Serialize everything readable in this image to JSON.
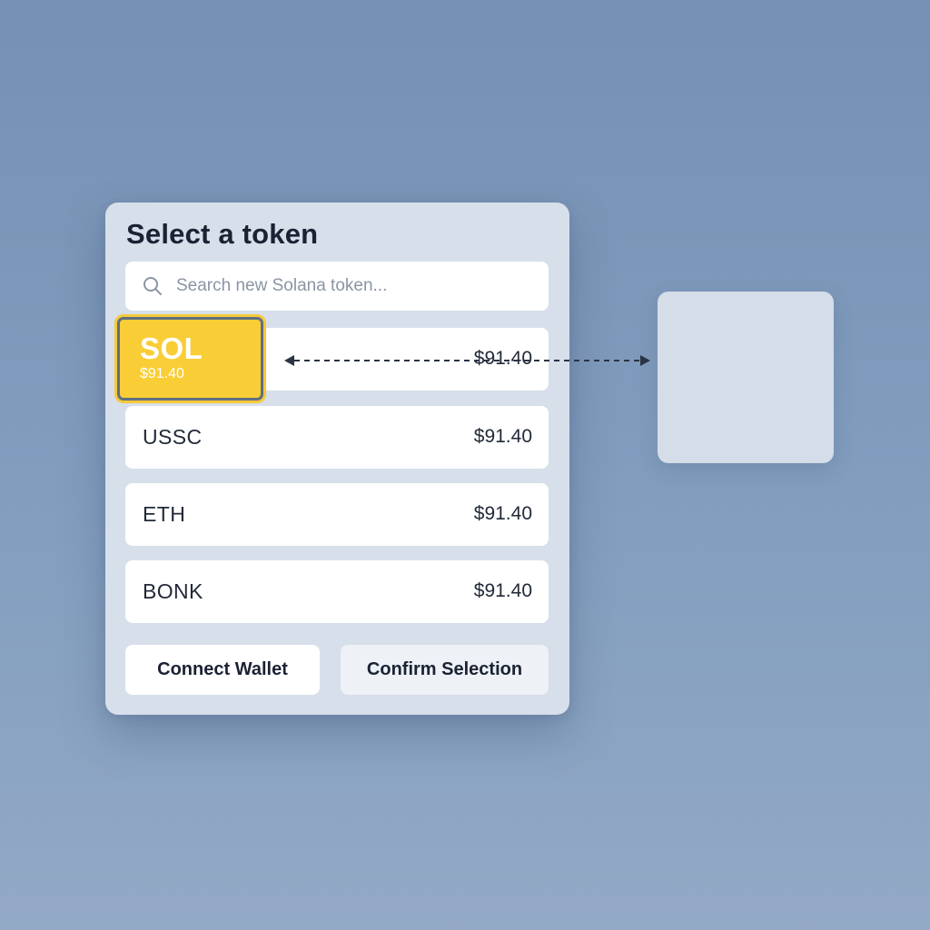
{
  "picker": {
    "title": "Select a token",
    "search": {
      "placeholder": "Search new Solana token..."
    },
    "selected": {
      "symbol": "SOL",
      "price": "$91.40"
    },
    "tokens": [
      {
        "symbol": "SOL",
        "price": "$91.40"
      },
      {
        "symbol": "USSC",
        "price": "$91.40"
      },
      {
        "symbol": "ETH",
        "price": "$91.40"
      },
      {
        "symbol": "BONK",
        "price": "$91.40"
      }
    ],
    "buttons": {
      "connect_label": "Connect Wallet",
      "confirm_label": "Confirm Selection"
    }
  },
  "colors": {
    "accent": "#f9cd35",
    "panel": "#d7dfea",
    "text": "#1a2233"
  }
}
